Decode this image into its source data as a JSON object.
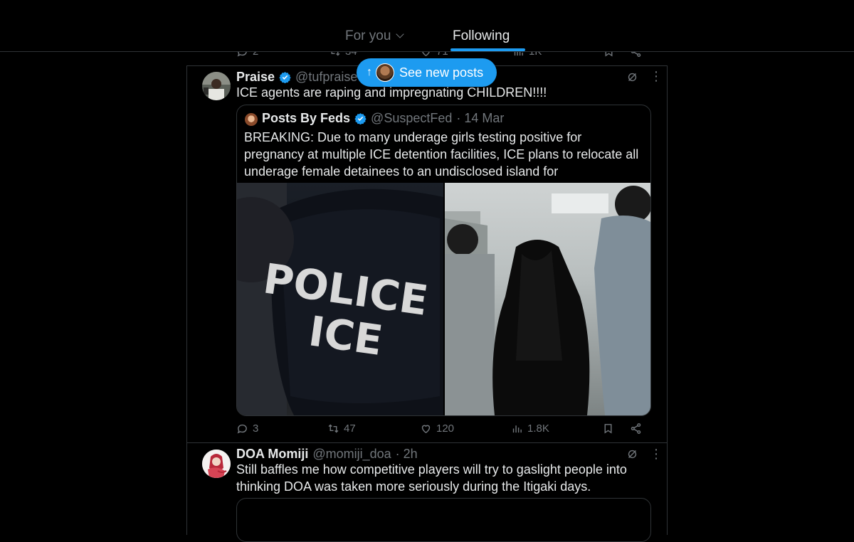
{
  "header": {
    "tabs": [
      {
        "label": "For you"
      },
      {
        "label": "Following"
      }
    ]
  },
  "prev_post": {
    "replies": "2",
    "reposts": "34",
    "likes": "71",
    "views": "1K"
  },
  "new_posts_pill": {
    "label": "See new posts",
    "arrow": "↑"
  },
  "post1": {
    "display_name": "Praise",
    "handle": "@tufpraise",
    "text": "ICE agents are raping and impregnating CHILDREN!!!!",
    "quote": {
      "display_name": "Posts By Feds",
      "handle": "@SuspectFed",
      "time": "· 14 Mar",
      "text": "BREAKING: Due to many underage girls testing positive for pregnancy at multiple ICE detention facilities, ICE plans to relocate all underage female detainees to an undisclosed island for 'safeguarding'.",
      "image_text_line1": "POLICE",
      "image_text_line2": "ICE"
    },
    "replies": "3",
    "reposts": "47",
    "likes": "120",
    "views": "1.8K"
  },
  "post2": {
    "display_name": "DOA Momiji",
    "handle": "@momiji_doa",
    "time": "· 2h",
    "text": "Still baffles me how competitive players will try to gaslight people into thinking DOA was taken more seriously during the Itigaki days."
  },
  "colors": {
    "accent": "#1d9bf0",
    "muted": "#71767b",
    "text": "#e7e9ea",
    "border": "#2f3336"
  },
  "icons": [
    "reply-icon",
    "repost-icon",
    "like-icon",
    "views-icon",
    "bookmark-icon",
    "share-icon",
    "verified-icon",
    "grok-icon",
    "more-icon",
    "chevron-down-icon",
    "up-arrow-icon"
  ]
}
